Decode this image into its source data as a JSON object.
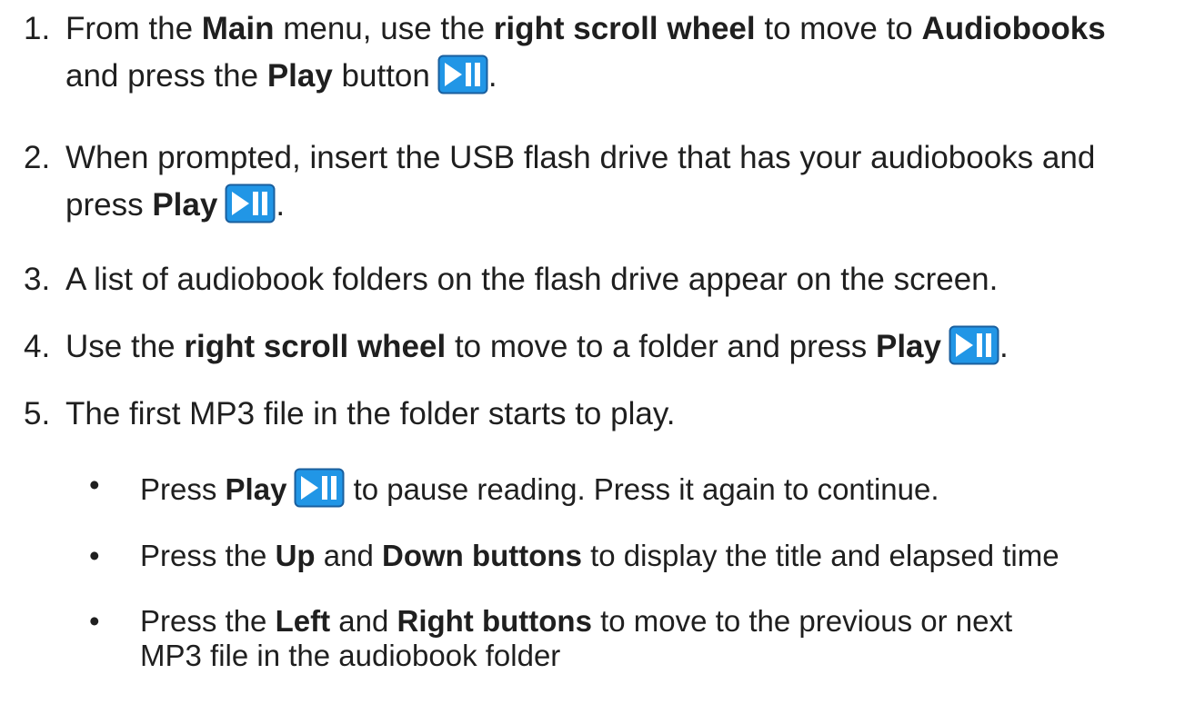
{
  "steps": [
    {
      "number": "1.",
      "line1": {
        "p1": "From the ",
        "b1": "Main",
        "p2": " menu, use the ",
        "b2": "right scroll wheel",
        "p3": " to move to ",
        "b3": "Audiobooks"
      },
      "line2": {
        "p1": "and press the ",
        "b1": "Play",
        "p2": " button",
        "end": "."
      }
    },
    {
      "number": "2.",
      "line1": {
        "p1": "When prompted, insert the USB flash drive that has your audiobooks and"
      },
      "line2": {
        "p1": "press ",
        "b1": "Play",
        "end": "."
      }
    },
    {
      "number": "3.",
      "line1": {
        "p1": "A list of audiobook folders on the flash drive appear on the screen."
      }
    },
    {
      "number": "4.",
      "line1": {
        "p1": "Use the ",
        "b1": "right scroll wheel",
        "p2": " to move to a folder and press ",
        "b2": "Play",
        "end": "."
      }
    },
    {
      "number": "5.",
      "line1": {
        "p1": "The first MP3 file in the folder starts to play."
      }
    }
  ],
  "bullets": [
    {
      "marker": "•",
      "p1": "Press ",
      "b1": "Play",
      "p2": " to pause reading. Press it again to continue."
    },
    {
      "marker": "•",
      "p1": "Press the ",
      "b1": "Up",
      "p2": " and ",
      "b2": "Down buttons",
      "p3": " to display the title and elapsed time"
    },
    {
      "marker": "•",
      "p1": "Press the ",
      "b1": "Left",
      "p2": " and ",
      "b2": "Right buttons",
      "p3": " to move to the previous or next",
      "line2": "MP3 file in the audiobook folder"
    }
  ],
  "play_icon": {
    "name": "play-pause-icon",
    "fill": "#2196e6",
    "border": "#1a5f9e",
    "glyph": "#ffffff"
  }
}
